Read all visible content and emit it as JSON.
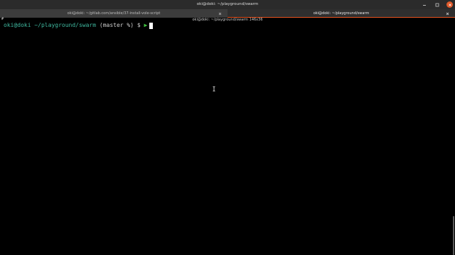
{
  "window": {
    "title": "oki@doki: ~/playground/swarm",
    "controls": {
      "minimize_icon": "minimize-icon",
      "maximize_icon": "maximize-icon",
      "close_icon": "close-icon"
    }
  },
  "tabs": [
    {
      "label": "oki@doki: ~/gitlab.com/ansible/37-install-vole-script",
      "active": false
    },
    {
      "label": "oki@doki: ~/playground/swarm",
      "active": true
    }
  ],
  "terminal": {
    "size_indicator": "oki@doki: ~/playground/swarm 146x36",
    "corner_mark": "#",
    "prompt": {
      "user_host": "oki@doki",
      "path": "~/playground/swarm",
      "branch": "(master %)",
      "dollar": "$",
      "arrow": "▶"
    }
  },
  "colors": {
    "accent": "#e95420",
    "prompt_green": "#3fb9a0",
    "arrow_green": "#3fbf3f",
    "background": "#000000"
  }
}
